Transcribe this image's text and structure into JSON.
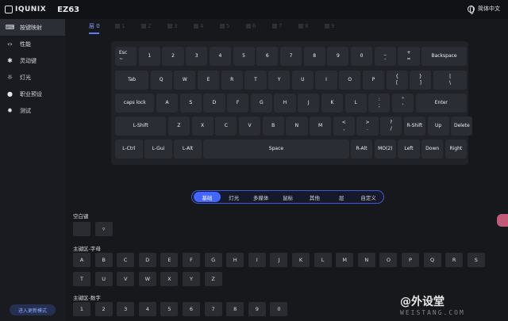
{
  "app": {
    "brand": "IQUNIX",
    "model": "EZ63",
    "language": "简体中文"
  },
  "sidebar": {
    "items": [
      {
        "label": "按键映射",
        "icon": "keyboard-icon",
        "active": true
      },
      {
        "label": "性能",
        "icon": "code-icon",
        "active": false
      },
      {
        "label": "灵动键",
        "icon": "gear-icon",
        "active": false
      },
      {
        "label": "灯光",
        "icon": "lightbulb-icon",
        "active": false
      },
      {
        "label": "职业预设",
        "icon": "user-icon",
        "active": false
      },
      {
        "label": "测试",
        "icon": "bug-icon",
        "active": false
      }
    ],
    "update_label": "进入更新模式"
  },
  "layers": [
    "层 0",
    "1",
    "2",
    "3",
    "4",
    "5",
    "6",
    "7",
    "8",
    "9"
  ],
  "keyboard": {
    "rows": [
      [
        {
          "l": "Esc",
          "s": "~"
        },
        {
          "l": "1"
        },
        {
          "l": "2"
        },
        {
          "l": "3"
        },
        {
          "l": "4"
        },
        {
          "l": "5"
        },
        {
          "l": "6"
        },
        {
          "l": "7"
        },
        {
          "l": "8"
        },
        {
          "l": "9"
        },
        {
          "l": "0"
        },
        {
          "l": "_",
          "s": "-"
        },
        {
          "l": "+",
          "s": "="
        },
        {
          "l": "Backspace"
        }
      ],
      [
        {
          "l": "Tab"
        },
        {
          "l": "Q"
        },
        {
          "l": "W"
        },
        {
          "l": "E"
        },
        {
          "l": "R"
        },
        {
          "l": "T"
        },
        {
          "l": "Y"
        },
        {
          "l": "U"
        },
        {
          "l": "I"
        },
        {
          "l": "O"
        },
        {
          "l": "P"
        },
        {
          "l": "{",
          "s": "["
        },
        {
          "l": "}",
          "s": "]"
        },
        {
          "l": "|",
          "s": "\\"
        }
      ],
      [
        {
          "l": "caps lock"
        },
        {
          "l": "A"
        },
        {
          "l": "S"
        },
        {
          "l": "D"
        },
        {
          "l": "F"
        },
        {
          "l": "G"
        },
        {
          "l": "H"
        },
        {
          "l": "J"
        },
        {
          "l": "K"
        },
        {
          "l": "L"
        },
        {
          "l": ":",
          "s": ";"
        },
        {
          "l": "\"",
          "s": "'"
        },
        {
          "l": "Enter"
        }
      ],
      [
        {
          "l": "L-Shift"
        },
        {
          "l": "Z"
        },
        {
          "l": "X"
        },
        {
          "l": "C"
        },
        {
          "l": "V"
        },
        {
          "l": "B"
        },
        {
          "l": "N"
        },
        {
          "l": "M"
        },
        {
          "l": "<",
          "s": ","
        },
        {
          "l": ">",
          "s": "."
        },
        {
          "l": "?",
          "s": "/"
        },
        {
          "l": "R-Shift"
        },
        {
          "l": "Up"
        },
        {
          "l": "Delete"
        }
      ],
      [
        {
          "l": "L-Ctrl"
        },
        {
          "l": "L-Gui"
        },
        {
          "l": "L-Alt"
        },
        {
          "l": "Space"
        },
        {
          "l": "R-Alt"
        },
        {
          "l": "MO(2)"
        },
        {
          "l": "Left"
        },
        {
          "l": "Down"
        },
        {
          "l": "Right"
        }
      ]
    ]
  },
  "categories": [
    {
      "label": "基础",
      "active": true
    },
    {
      "label": "灯光",
      "active": false
    },
    {
      "label": "多媒体",
      "active": false
    },
    {
      "label": "鼠标",
      "active": false
    },
    {
      "label": "其他",
      "active": false
    },
    {
      "label": "层",
      "active": false
    },
    {
      "label": "自定义",
      "active": false
    }
  ],
  "groups": {
    "blank": {
      "title": "空白键",
      "keys": [
        "",
        "▿"
      ]
    },
    "letters": {
      "title": "主键区-字母",
      "keys": [
        "A",
        "B",
        "C",
        "D",
        "E",
        "F",
        "G",
        "H",
        "I",
        "J",
        "K",
        "L",
        "M",
        "N",
        "O",
        "P",
        "Q",
        "R",
        "S",
        "T",
        "U",
        "V",
        "W",
        "X",
        "Y",
        "Z"
      ]
    },
    "numbers": {
      "title": "主键区-数字",
      "keys": [
        "1",
        "2",
        "3",
        "4",
        "5",
        "6",
        "7",
        "8",
        "9",
        "0"
      ]
    }
  },
  "watermark": {
    "text": "@外设堂",
    "sub": "WEISTANG.COM"
  }
}
